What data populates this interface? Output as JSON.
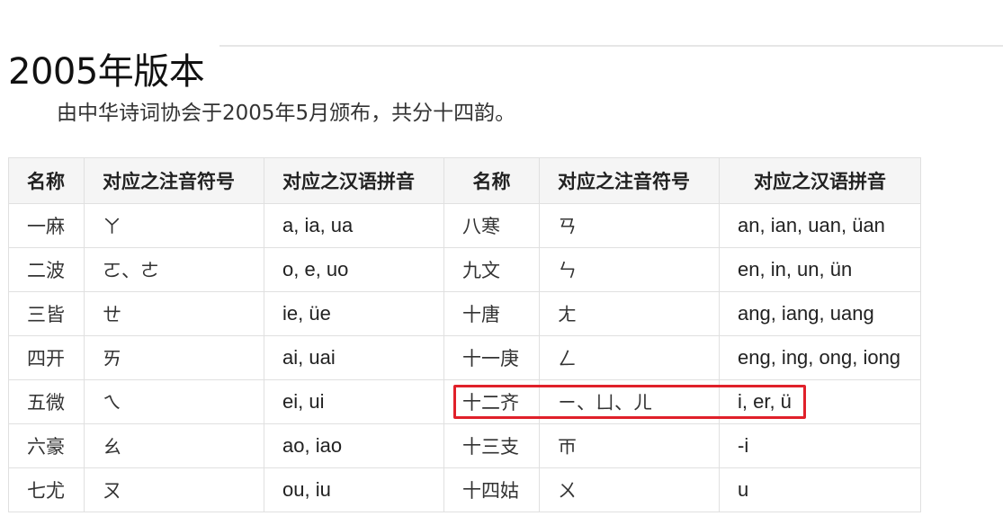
{
  "heading": {
    "title": "2005年版本"
  },
  "intro": {
    "text": "由中华诗词协会于2005年5月颁布，共分十四韵。"
  },
  "table": {
    "headers": [
      "名称",
      "对应之注音符号",
      "对应之汉语拼音",
      "名称",
      "对应之注音符号",
      "对应之汉语拼音"
    ],
    "rows": [
      {
        "name_left": "一麻",
        "zhuyin_left": "ㄚ",
        "pinyin_left": "a, ia, ua",
        "name_right": "八寒",
        "zhuyin_right": "ㄢ",
        "pinyin_right": "an, ian, uan, üan"
      },
      {
        "name_left": "二波",
        "zhuyin_left": "ㄛ、ㄜ",
        "pinyin_left": "o, e, uo",
        "name_right": "九文",
        "zhuyin_right": "ㄣ",
        "pinyin_right": "en, in, un, ün"
      },
      {
        "name_left": "三皆",
        "zhuyin_left": "ㄝ",
        "pinyin_left": "ie, üe",
        "name_right": "十唐",
        "zhuyin_right": "ㄤ",
        "pinyin_right": "ang, iang, uang"
      },
      {
        "name_left": "四开",
        "zhuyin_left": "ㄞ",
        "pinyin_left": "ai, uai",
        "name_right": "十一庚",
        "zhuyin_right": "ㄥ",
        "pinyin_right": "eng, ing, ong, iong"
      },
      {
        "name_left": "五微",
        "zhuyin_left": "ㄟ",
        "pinyin_left": "ei, ui",
        "name_right": "十二齐",
        "zhuyin_right": "ㄧ、ㄩ、ㄦ",
        "pinyin_right": "i, er, ü"
      },
      {
        "name_left": "六豪",
        "zhuyin_left": "ㄠ",
        "pinyin_left": "ao, iao",
        "name_right": "十三支",
        "zhuyin_right": "ㄭ",
        "pinyin_right": "-i"
      },
      {
        "name_left": "七尤",
        "zhuyin_left": "ㄡ",
        "pinyin_left": "ou, iu",
        "name_right": "十四姑",
        "zhuyin_right": "ㄨ",
        "pinyin_right": "u"
      }
    ]
  },
  "colors": {
    "highlight": "#e0202a",
    "header_bg": "#f5f5f5",
    "border": "#e0e0e0"
  }
}
